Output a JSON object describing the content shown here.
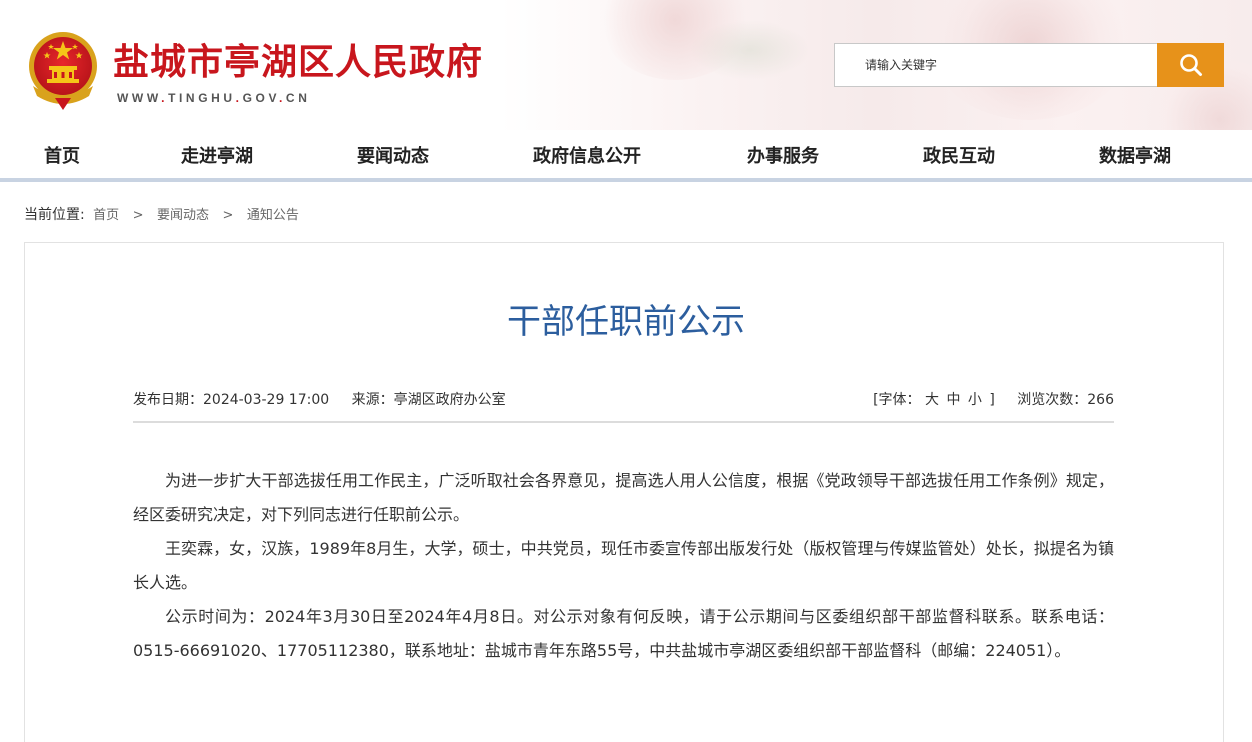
{
  "header": {
    "site_title": "盐城市亭湖区人民政府",
    "site_url": [
      "WWW",
      "TINGHU",
      "GOV",
      "CN"
    ],
    "search_placeholder": "请输入关键字",
    "search_icon": "search-icon"
  },
  "nav": {
    "items": [
      {
        "label": "首页"
      },
      {
        "label": "走进亭湖"
      },
      {
        "label": "要闻动态"
      },
      {
        "label": "政府信息公开"
      },
      {
        "label": "办事服务"
      },
      {
        "label": "政民互动"
      },
      {
        "label": "数据亭湖"
      }
    ]
  },
  "breadcrumb": {
    "prefix": "当前位置:",
    "items": [
      "首页",
      "要闻动态",
      "通知公告"
    ],
    "separator": ">"
  },
  "article": {
    "title": "干部任职前公示",
    "publish_date": "发布日期：2024-03-29 17:00",
    "source": "来源：亭湖区政府办公室",
    "font_label": "[字体：",
    "font_large": "大",
    "font_medium": "中",
    "font_small": "小",
    "font_close": "]",
    "views": "浏览次数：266",
    "paragraphs": [
      "为进一步扩大干部选拔任用工作民主，广泛听取社会各界意见，提高选人用人公信度，根据《党政领导干部选拔任用工作条例》规定，经区委研究决定，对下列同志进行任职前公示。",
      "王奕霖，女，汉族，1989年8月生，大学，硕士，中共党员，现任市委宣传部出版发行处（版权管理与传媒监管处）处长，拟提名为镇长人选。",
      "公示时间为：2024年3月30日至2024年4月8日。对公示对象有何反映，请于公示期间与区委组织部干部监督科联系。联系电话：0515-66691020、17705112380，联系地址：盐城市青年东路55号，中共盐城市亭湖区委组织部干部监督科（邮编：224051）。"
    ]
  },
  "colors": {
    "brand_red": "#c8161d",
    "search_orange": "#e7921a",
    "title_blue": "#2c5e9e",
    "nav_underline": "#c8d3e2"
  }
}
